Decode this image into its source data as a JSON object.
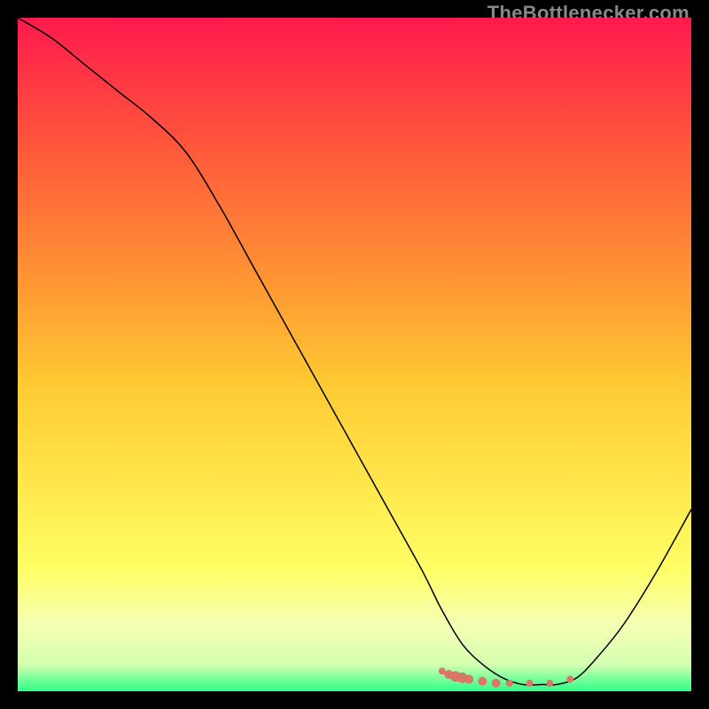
{
  "watermark": "TheBottlenecker.com",
  "chart_data": {
    "type": "line",
    "title": "",
    "xlabel": "",
    "ylabel": "",
    "xlim": [
      0,
      100
    ],
    "ylim": [
      0,
      100
    ],
    "grid": false,
    "legend": false,
    "background_gradient": {
      "stops": [
        {
          "offset": 0.0,
          "color": "#ff1a4d"
        },
        {
          "offset": 0.2,
          "color": "#ff5a3a"
        },
        {
          "offset": 0.4,
          "color": "#ff9933"
        },
        {
          "offset": 0.55,
          "color": "#ffcc33"
        },
        {
          "offset": 0.7,
          "color": "#ffe84d"
        },
        {
          "offset": 0.82,
          "color": "#ffff66"
        },
        {
          "offset": 0.9,
          "color": "#f5ffb3"
        },
        {
          "offset": 0.96,
          "color": "#d4ffb0"
        },
        {
          "offset": 1.0,
          "color": "#2eff88"
        }
      ]
    },
    "series": [
      {
        "name": "bottleneck-curve",
        "color": "#000000",
        "width": 1.2,
        "x": [
          0,
          5,
          10,
          15,
          20,
          25,
          30,
          35,
          40,
          45,
          50,
          55,
          60,
          63,
          66,
          69,
          72,
          75,
          78,
          80,
          83,
          86,
          90,
          95,
          100
        ],
        "y": [
          100,
          97,
          93,
          89,
          85,
          80,
          72,
          63,
          54,
          45,
          36,
          27,
          18,
          12,
          7,
          4,
          2,
          1,
          1,
          1,
          2,
          5,
          10,
          18,
          27
        ]
      }
    ],
    "bottom_markers": {
      "name": "bottom-band-markers",
      "color": "#d9776b",
      "points": [
        {
          "x": 63,
          "y": 3,
          "r": 4
        },
        {
          "x": 64,
          "y": 2.5,
          "r": 5
        },
        {
          "x": 65,
          "y": 2.2,
          "r": 6
        },
        {
          "x": 66,
          "y": 2,
          "r": 6
        },
        {
          "x": 67,
          "y": 1.8,
          "r": 5
        },
        {
          "x": 69,
          "y": 1.5,
          "r": 5
        },
        {
          "x": 71,
          "y": 1.2,
          "r": 5
        },
        {
          "x": 73,
          "y": 1.2,
          "r": 4
        },
        {
          "x": 76,
          "y": 1.2,
          "r": 4
        },
        {
          "x": 79,
          "y": 1.2,
          "r": 4
        },
        {
          "x": 82,
          "y": 1.8,
          "r": 4
        }
      ]
    }
  }
}
